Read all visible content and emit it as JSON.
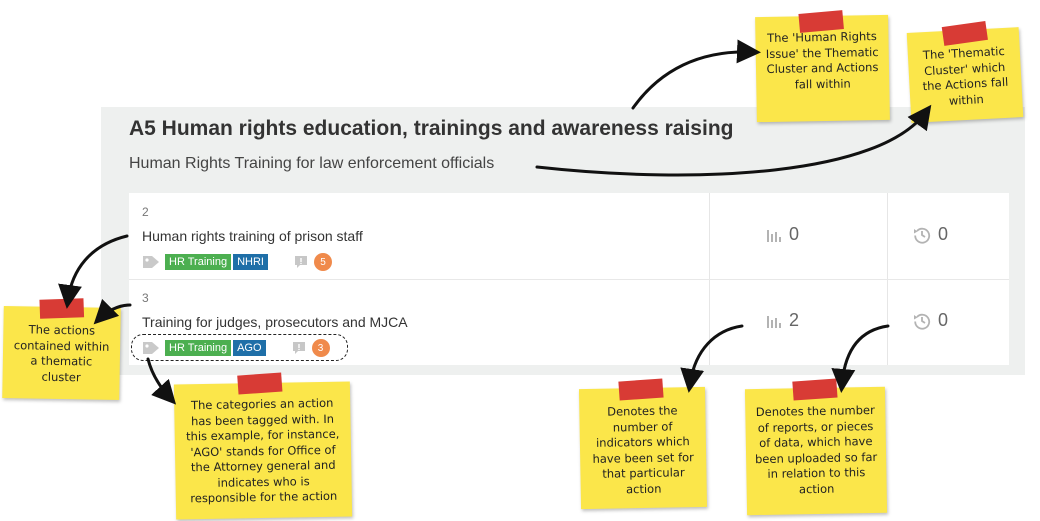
{
  "cluster": {
    "title": "A5 Human rights education, trainings and awareness raising",
    "subtitle": "Human Rights Training for law enforcement officials"
  },
  "actions": [
    {
      "number": "2",
      "title": "Human rights training of prison staff",
      "tags": [
        {
          "label": "HR Training",
          "color": "#4caf50"
        },
        {
          "label": "NHRI",
          "color": "#1f6fa8"
        }
      ],
      "comments": "5",
      "indicators": "0",
      "reports": "0"
    },
    {
      "number": "3",
      "title": "Training for judges, prosecutors and MJCA",
      "tags": [
        {
          "label": "HR Training",
          "color": "#4caf50"
        },
        {
          "label": "AGO",
          "color": "#1f6fa8"
        }
      ],
      "comments": "3",
      "indicators": "2",
      "reports": "0"
    }
  ],
  "notes": {
    "issue": "The 'Human Rights Issue' the Thematic Cluster and Actions fall within",
    "cluster": "The 'Thematic Cluster' which the Actions fall within",
    "actions": "The actions contained within a thematic cluster",
    "categories": "The categories an action has been tagged with. In this example, for instance, 'AGO' stands for Office of the Attorney general and indicates who is responsible for the action",
    "indicators": "Denotes the number of indicators which have been set for that particular action",
    "reports": "Denotes the number of reports, or pieces of data, which have been uploaded so far in relation to this action"
  },
  "icons": {
    "tag": "tag-icon",
    "comment": "comment-icon",
    "indicators": "bar-chart-icon",
    "reports": "clock-history-icon"
  }
}
